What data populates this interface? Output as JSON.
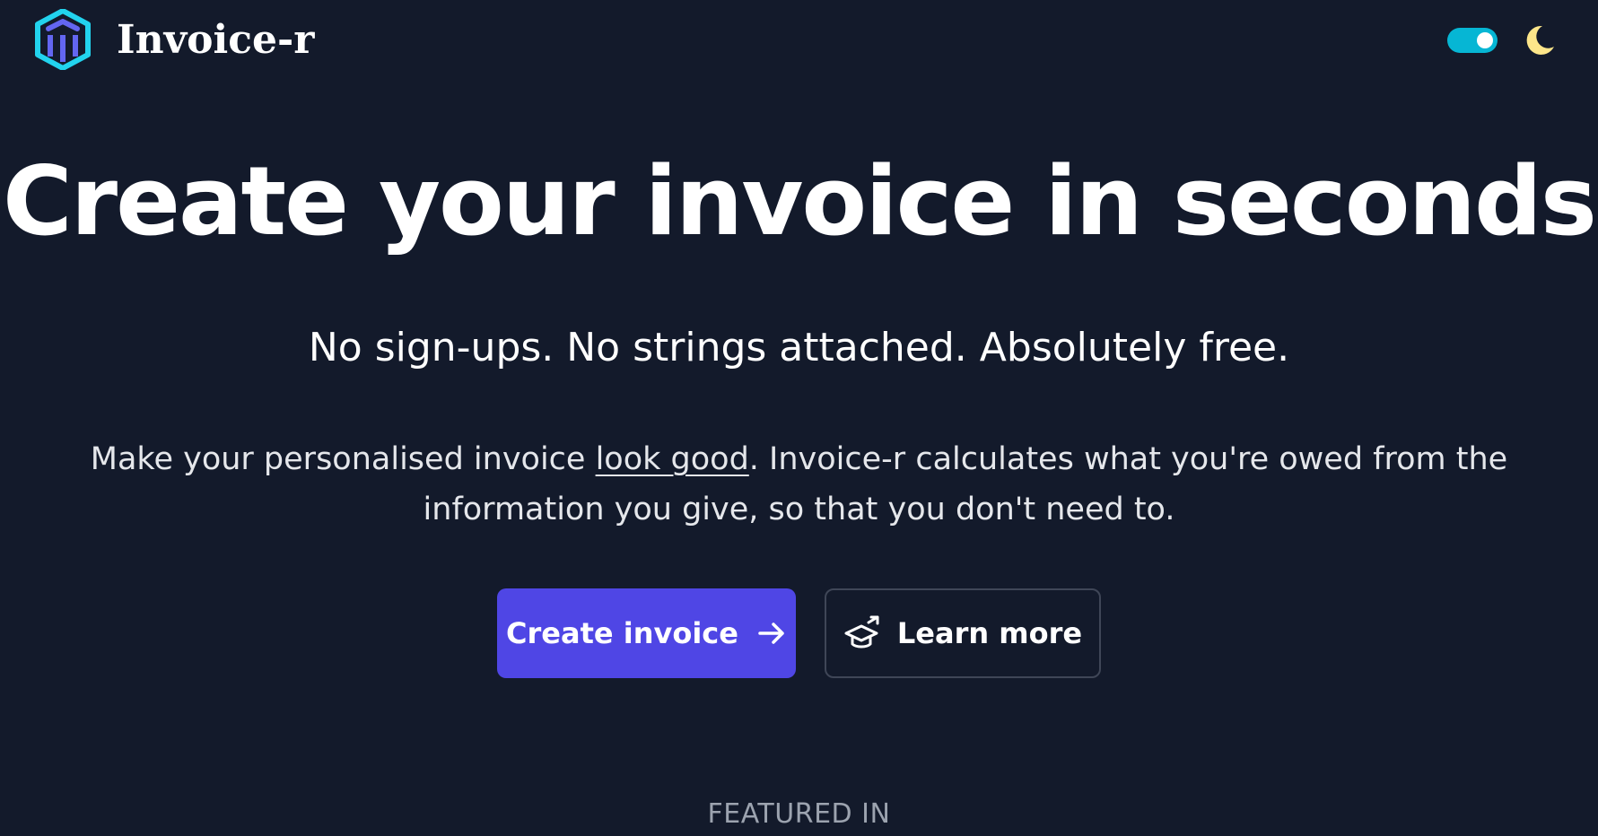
{
  "header": {
    "brand_name": "Invoice-r",
    "logo_icon": "building-columns-logo",
    "theme_toggle_state": "on",
    "theme_icon": "moon-icon"
  },
  "hero": {
    "title": "Create your invoice in seconds",
    "tagline": "No sign-ups. No strings attached. Absolutely free.",
    "description_before": "Make your personalised invoice ",
    "description_link": "look good",
    "description_after": ". Invoice-r calculates what you're owed from the information you give, so that you don't need to."
  },
  "buttons": {
    "primary_label": "Create invoice",
    "primary_icon": "arrow-right-icon",
    "secondary_label": "Learn more",
    "secondary_icon": "graduation-cap-icon"
  },
  "featured": {
    "heading": "FEATURED IN"
  },
  "colors": {
    "background": "#131a2b",
    "primary": "#4f46e5",
    "toggle": "#06b6d4",
    "moon": "#fde68a",
    "logo_light": "#22d3ee",
    "logo_dark": "#6366f1"
  }
}
